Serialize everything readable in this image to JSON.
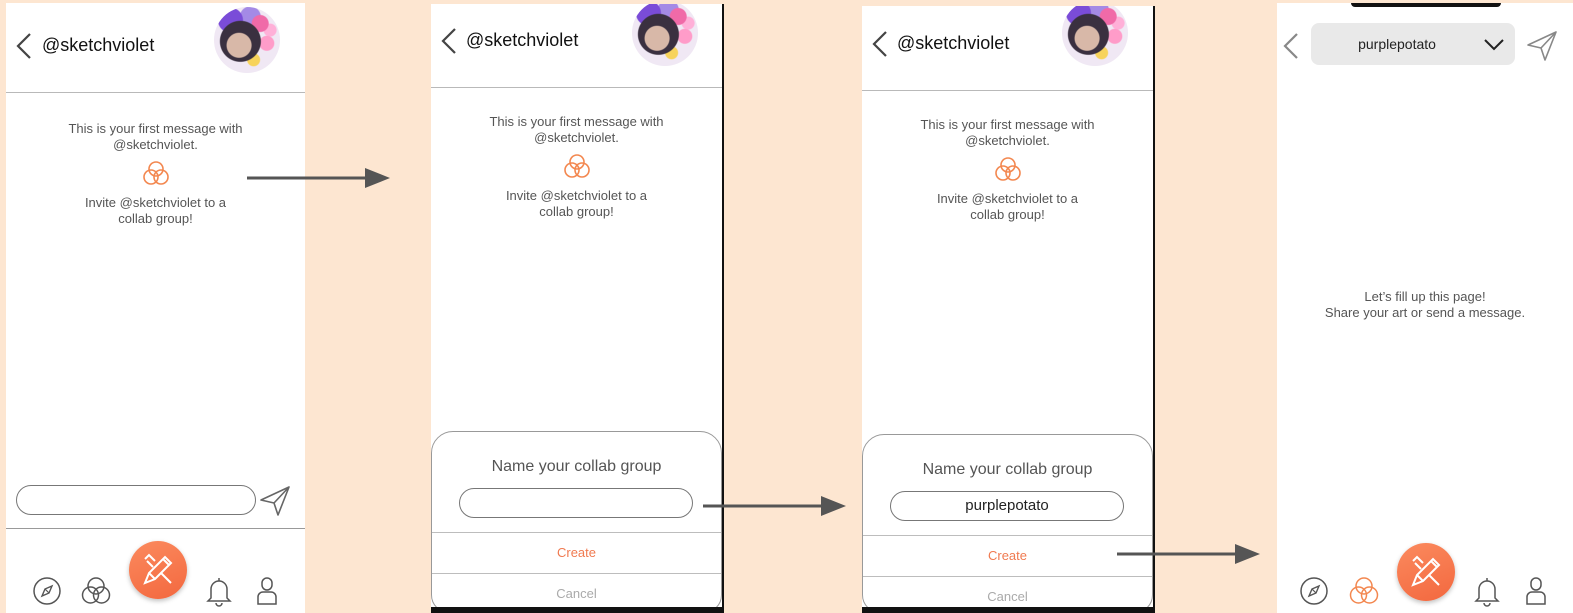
{
  "user": {
    "handle": "@sketchviolet"
  },
  "intro": {
    "first_line_1": "This is your first message with",
    "first_line_2": "@sketchviolet.",
    "invite_line_1": "Invite @sketchviolet to a",
    "invite_line_2": "collab group!"
  },
  "sheet": {
    "title": "Name your collab group",
    "input_empty": "",
    "input_filled": "purplepotato",
    "create_label": "Create",
    "cancel_label": "Cancel"
  },
  "group_chat": {
    "group_name": "purplepotato",
    "empty_line_1": "Let’s fill up this page!",
    "empty_line_2": "Share your art or send a message."
  },
  "icons": {
    "back": "back-chevron-icon",
    "send": "send-paper-plane-icon",
    "collab": "collab-circles-icon",
    "explore": "compass-icon",
    "create": "pencil-brush-icon",
    "notifications": "bell-icon",
    "profile": "person-icon",
    "dropdown": "chevron-down-icon"
  },
  "colors": {
    "background": "#fde6d1",
    "accent": "#f3683f",
    "accent_light": "#fb8a5e",
    "text_muted": "#555555"
  }
}
